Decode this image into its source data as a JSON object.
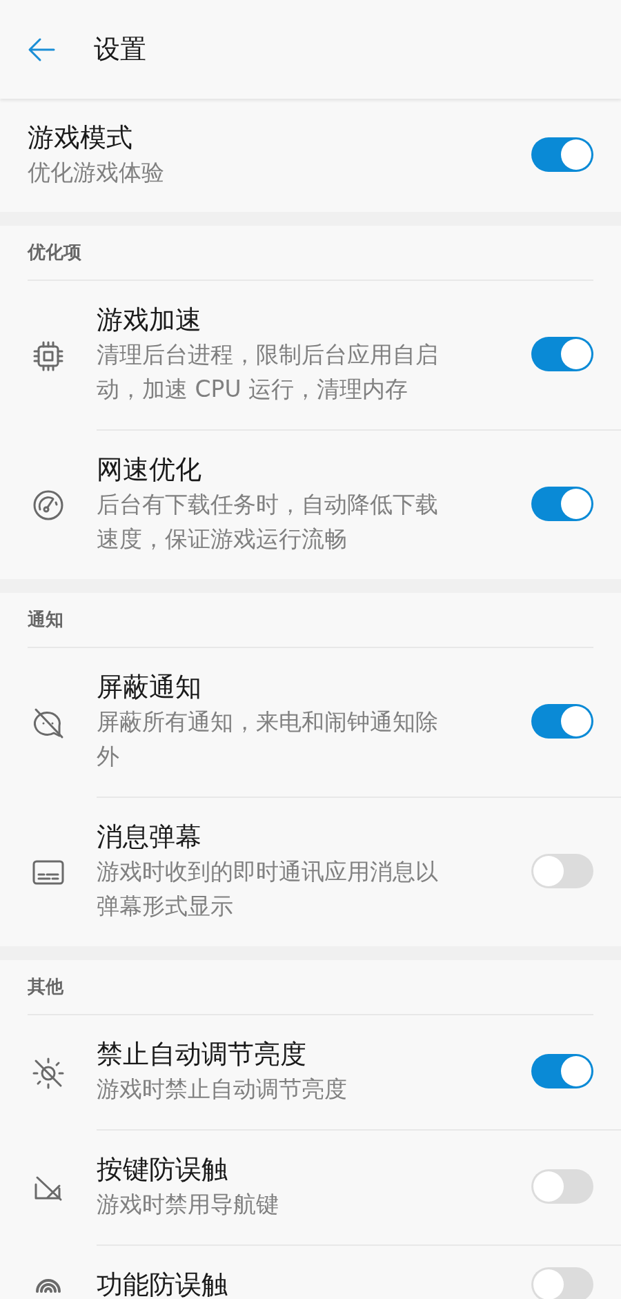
{
  "header": {
    "title": "设置"
  },
  "master": {
    "title": "游戏模式",
    "description": "优化游戏体验",
    "on": true
  },
  "sections": [
    {
      "label": "优化项",
      "items": [
        {
          "kind": "chip",
          "title": "游戏加速",
          "description": "清理后台进程，限制后台应用自启动，加速 CPU 运行，清理内存",
          "on": true
        },
        {
          "kind": "gauge",
          "title": "网速优化",
          "description": "后台有下载任务时，自动降低下载速度，保证游戏运行流畅",
          "on": true
        }
      ]
    },
    {
      "label": "通知",
      "items": [
        {
          "kind": "mute-chat",
          "title": "屏蔽通知",
          "description": "屏蔽所有通知，来电和闹钟通知除外",
          "on": true
        },
        {
          "kind": "subtitles",
          "title": "消息弹幕",
          "description": "游戏时收到的即时通讯应用消息以弹幕形式显示",
          "on": false
        }
      ]
    },
    {
      "label": "其他",
      "items": [
        {
          "kind": "sun-off",
          "title": "禁止自动调节亮度",
          "description": "游戏时禁止自动调节亮度",
          "on": true
        },
        {
          "kind": "keys-off",
          "title": "按键防误触",
          "description": "游戏时禁用导航键",
          "on": false
        },
        {
          "kind": "touch",
          "title": "功能防误触",
          "on": false
        }
      ]
    }
  ]
}
